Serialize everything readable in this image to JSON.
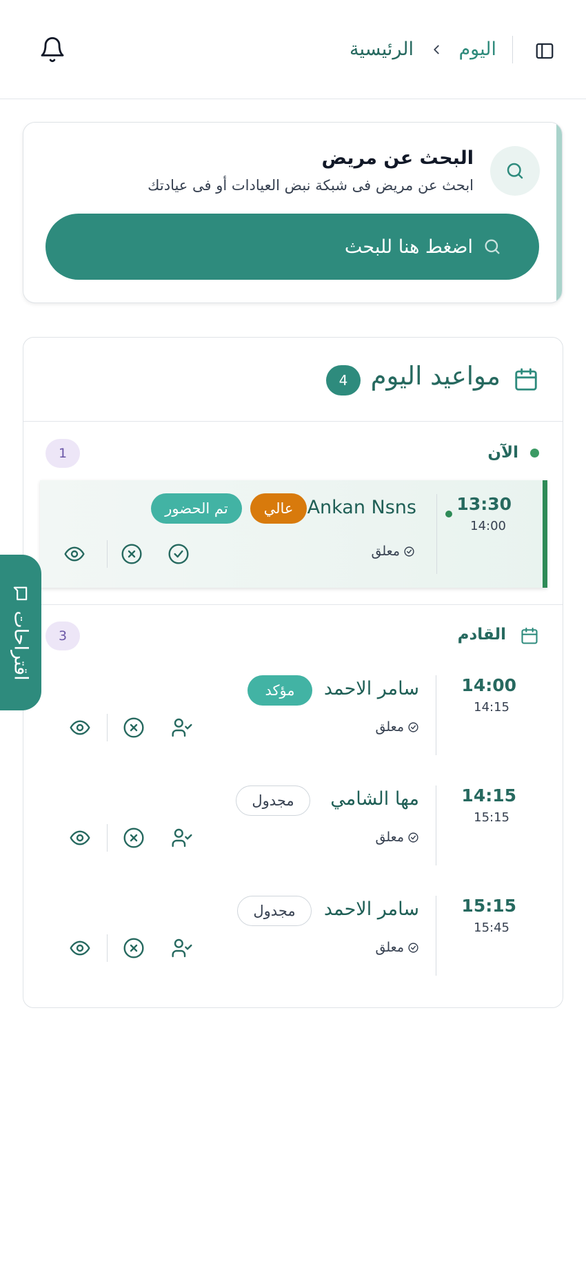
{
  "header": {
    "breadcrumb": {
      "current": "اليوم",
      "home": "الرئيسية"
    },
    "icons": {
      "sidebar_toggle": "sidebar-panel-icon",
      "separator": "chevron-left-icon",
      "notifications": "bell-icon"
    }
  },
  "search_card": {
    "title": "البحث عن مريض",
    "subtitle": "ابحث عن مريض فى شبكة نبض العيادات أو فى عيادتك",
    "button_label": "اضغط هنا للبحث",
    "icon": "search-icon"
  },
  "appointments": {
    "title": "مواعيد اليوم",
    "count": "4",
    "now_section": {
      "label": "الآن",
      "count": "1",
      "items": [
        {
          "start": "13:30",
          "end": "14:00",
          "patient": "Ankan Nsns",
          "priority": "عالي",
          "state": "تم الحضور",
          "status": "معلق"
        }
      ]
    },
    "upcoming_section": {
      "label": "القادم",
      "count": "3",
      "items": [
        {
          "start": "14:00",
          "end": "14:15",
          "patient": "سامر الاحمد",
          "state": "مؤكد",
          "status": "معلق"
        },
        {
          "start": "14:15",
          "end": "15:15",
          "patient": "مها الشامي",
          "state": "مجدول",
          "status": "معلق"
        },
        {
          "start": "15:15",
          "end": "15:45",
          "patient": "سامر الاحمد",
          "state": "مجدول",
          "status": "معلق"
        }
      ]
    }
  },
  "suggestions_tab": {
    "label": "اقتراحات",
    "icon": "message-icon"
  },
  "colors": {
    "primary": "#2e8b7d",
    "primary_dark": "#26695f",
    "teal_pill": "#42b3a4",
    "orange_pill": "#d87a0c",
    "now_bar": "#2e8b57",
    "count_badge_bg": "#ede6f7",
    "count_badge_text": "#6a56a6"
  }
}
